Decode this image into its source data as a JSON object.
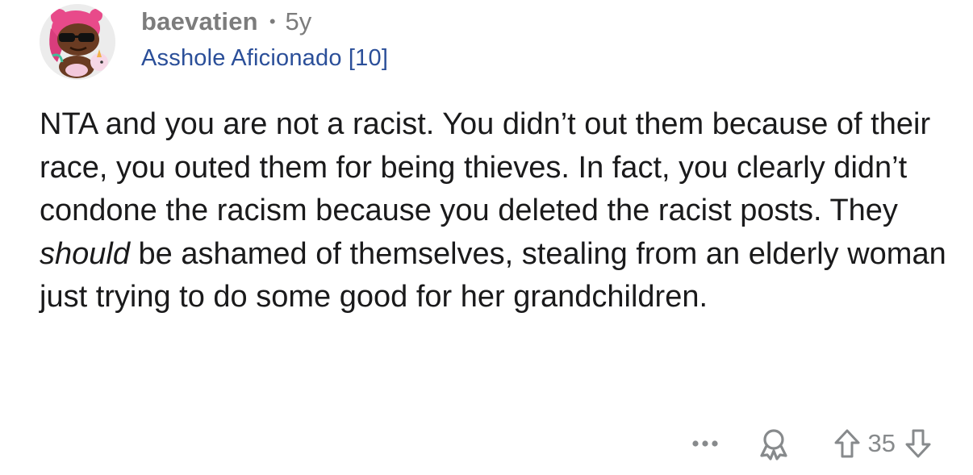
{
  "comment": {
    "author": {
      "username": "baevatien",
      "separator": "•",
      "age": "5y",
      "flair": "Asshole Aficionado [10]"
    },
    "body": {
      "part1": "NTA and you are not a racist. You didn’t out them because of their race, you outed them for being thieves. In fact, you clearly didn’t condone the racism because you deleted the racist posts. They ",
      "emphasis": "should",
      "part2": " be ashamed of themselves, stealing from an elderly woman just trying to do some good for her grandchildren."
    },
    "actions": {
      "more_label": "more options",
      "score": "35"
    }
  },
  "colors": {
    "text_primary": "#1a1a1b",
    "text_meta": "#7c7c7c",
    "flair": "#2b4f99",
    "icon": "#878a8c",
    "avatar_bg": "#ececec",
    "avatar_hair": "#e84a8a"
  },
  "icons": {
    "avatar": "snoo-avatar",
    "more": "ellipsis-icon",
    "award": "award-icon",
    "upvote": "upvote-arrow-icon",
    "downvote": "downvote-arrow-icon"
  }
}
